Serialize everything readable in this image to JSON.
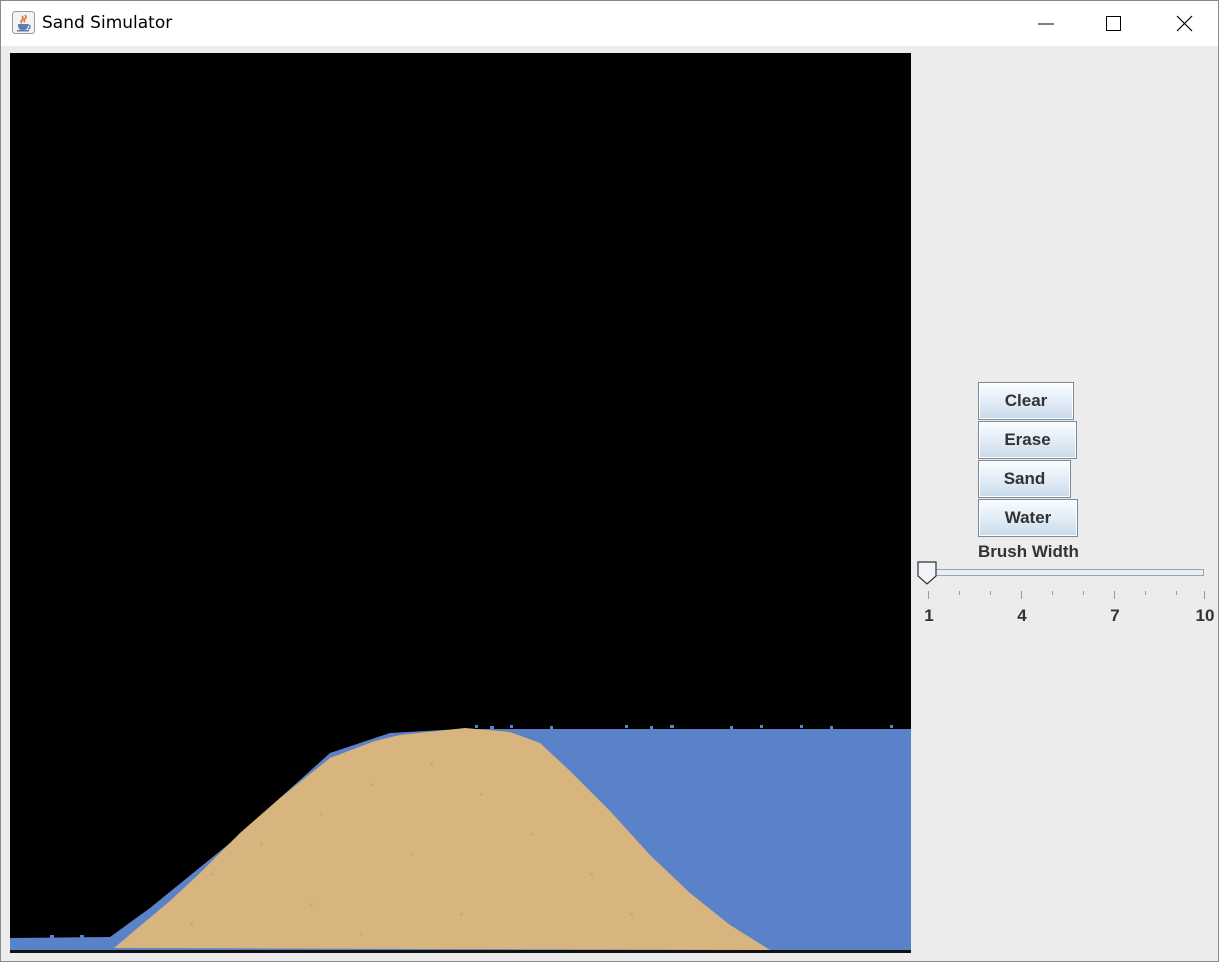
{
  "window": {
    "title": "Sand Simulator",
    "icon": "java-cup-icon",
    "controls": [
      "minimize-icon",
      "maximize-icon",
      "close-icon"
    ]
  },
  "canvas": {
    "background": "#000000",
    "sand_color": "#d8b47e",
    "water_color": "#5a82c8"
  },
  "controls": {
    "clear_label": "Clear",
    "erase_label": "Erase",
    "sand_label": "Sand",
    "water_label": "Water"
  },
  "brush": {
    "label": "Brush Width",
    "min": 1,
    "max": 10,
    "value": 1,
    "tick_labels": [
      "1",
      "4",
      "7",
      "10"
    ]
  }
}
